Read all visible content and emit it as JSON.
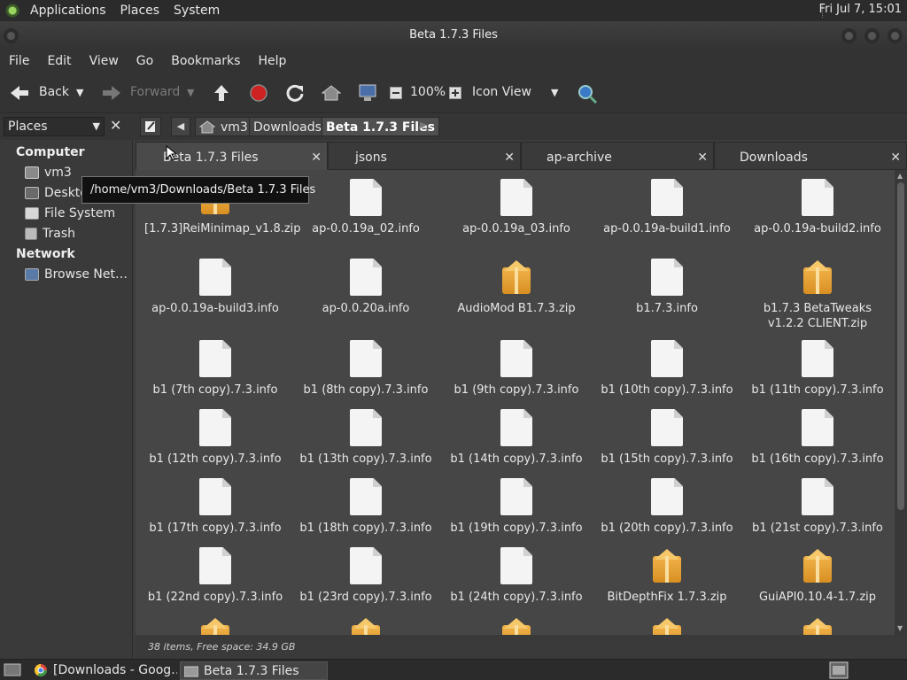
{
  "top_panel": {
    "menus": [
      "Applications",
      "Places",
      "System"
    ],
    "clock": "Fri Jul  7, 15:01"
  },
  "window": {
    "title": "Beta 1.7.3 Files"
  },
  "menubar": [
    "File",
    "Edit",
    "View",
    "Go",
    "Bookmarks",
    "Help"
  ],
  "toolbar": {
    "back_label": "Back",
    "forward_label": "Forward",
    "zoom": "100%",
    "view_mode": "Icon View"
  },
  "pathbar": {
    "places_label": "Places",
    "crumbs": [
      "vm3",
      "Downloads",
      "Beta 1.7.3 Files"
    ]
  },
  "sidebar": {
    "computer_heading": "Computer",
    "network_heading": "Network",
    "computer_items": [
      "vm3",
      "Desktop",
      "File System",
      "Trash"
    ],
    "network_items": [
      "Browse Net…"
    ]
  },
  "tabs": [
    "Beta 1.7.3 Files",
    "jsons",
    "ap-archive",
    "Downloads"
  ],
  "tooltip": "/home/vm3/Downloads/Beta 1.7.3 Files",
  "files": [
    {
      "name": "[1.7.3]ReiMinimap_v1.8.zip",
      "type": "zip"
    },
    {
      "name": "ap-0.0.19a_02.info",
      "type": "doc"
    },
    {
      "name": "ap-0.0.19a_03.info",
      "type": "doc"
    },
    {
      "name": "ap-0.0.19a-build1.info",
      "type": "doc"
    },
    {
      "name": "ap-0.0.19a-build2.info",
      "type": "doc"
    },
    {
      "name": "ap-0.0.19a-build3.info",
      "type": "doc"
    },
    {
      "name": "ap-0.0.20a.info",
      "type": "doc"
    },
    {
      "name": "AudioMod B1.7.3.zip",
      "type": "zip"
    },
    {
      "name": "b1.7.3.info",
      "type": "doc"
    },
    {
      "name": "b1.7.3 BetaTweaks v1.2.2 CLIENT.zip",
      "type": "zip"
    },
    {
      "name": "b1 (7th copy).7.3.info",
      "type": "doc"
    },
    {
      "name": "b1 (8th copy).7.3.info",
      "type": "doc"
    },
    {
      "name": "b1 (9th copy).7.3.info",
      "type": "doc"
    },
    {
      "name": "b1 (10th copy).7.3.info",
      "type": "doc"
    },
    {
      "name": "b1 (11th copy).7.3.info",
      "type": "doc"
    },
    {
      "name": "b1 (12th copy).7.3.info",
      "type": "doc"
    },
    {
      "name": "b1 (13th copy).7.3.info",
      "type": "doc"
    },
    {
      "name": "b1 (14th copy).7.3.info",
      "type": "doc"
    },
    {
      "name": "b1 (15th copy).7.3.info",
      "type": "doc"
    },
    {
      "name": "b1 (16th copy).7.3.info",
      "type": "doc"
    },
    {
      "name": "b1 (17th copy).7.3.info",
      "type": "doc"
    },
    {
      "name": "b1 (18th copy).7.3.info",
      "type": "doc"
    },
    {
      "name": "b1 (19th copy).7.3.info",
      "type": "doc"
    },
    {
      "name": "b1 (20th copy).7.3.info",
      "type": "doc"
    },
    {
      "name": "b1 (21st copy).7.3.info",
      "type": "doc"
    },
    {
      "name": "b1 (22nd copy).7.3.info",
      "type": "doc"
    },
    {
      "name": "b1 (23rd copy).7.3.info",
      "type": "doc"
    },
    {
      "name": "b1 (24th copy).7.3.info",
      "type": "doc"
    },
    {
      "name": "BitDepthFix 1.7.3.zip",
      "type": "zip"
    },
    {
      "name": "GuiAPI0.10.4-1.7.zip",
      "type": "zip"
    },
    {
      "name": "",
      "type": "zip"
    },
    {
      "name": "",
      "type": "zip"
    },
    {
      "name": "",
      "type": "zip"
    },
    {
      "name": "",
      "type": "zip"
    },
    {
      "name": "",
      "type": "zip"
    }
  ],
  "status": "38 items, Free space: 34.9 GB",
  "taskbar": {
    "tasks": [
      "[Downloads - Goog…",
      "Beta 1.7.3 Files"
    ]
  },
  "colors": {
    "zip_orange": "#e6a036",
    "doc_white": "#f4f4f4",
    "stop_red": "#cc2222"
  }
}
